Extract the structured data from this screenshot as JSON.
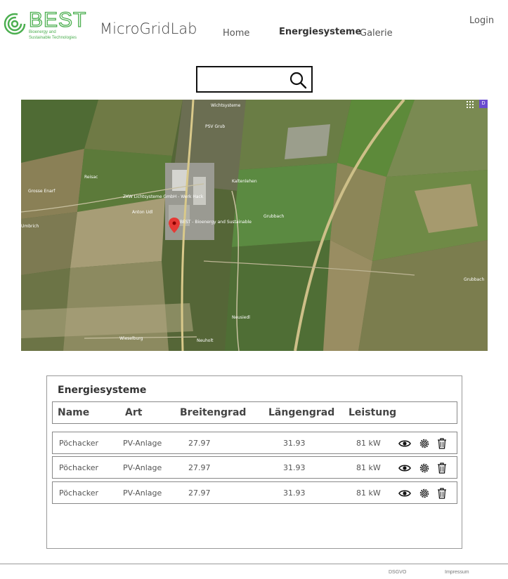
{
  "brand": {
    "logo_word": "BEST",
    "logo_sub_1": "Bioenergy and",
    "logo_sub_2": "Sustainable Technologies",
    "title": "MicroGridLab",
    "accent": "#4caf50"
  },
  "nav": {
    "home": "Home",
    "energy": "Energiesysteme",
    "gallery": "Galerie",
    "login": "Login"
  },
  "search": {
    "value": "",
    "placeholder": "",
    "icon": "search-icon"
  },
  "map": {
    "badge": "D",
    "labels": {
      "l1": "Wichtsysteme",
      "l2": "PSV Grub",
      "l3": "Grosse Enarf",
      "l4": "Reisac",
      "l5": "ZKW Lichtsysteme GmbH - Werk Hack",
      "l6": "Anton Udl",
      "l7": "BEST - Bioenergy and Sustainable",
      "l8": "Kaltenlehen",
      "l9": "Grubbach",
      "l10": "Grubbach",
      "l11": "Neusiedl",
      "l12": "Wieselburg",
      "l13": "Umbrich",
      "l14": "Neuholt"
    }
  },
  "table": {
    "title": "Energiesysteme",
    "headers": {
      "name": "Name",
      "type": "Art",
      "lat": "Breitengrad",
      "lon": "Längengrad",
      "power": "Leistung"
    },
    "rows": [
      {
        "name": "Pöchacker",
        "type": "PV-Anlage",
        "lat": "27.97",
        "lon": "31.93",
        "power": "81 kW"
      },
      {
        "name": "Pöchacker",
        "type": "PV-Anlage",
        "lat": "27.97",
        "lon": "31.93",
        "power": "81 kW"
      },
      {
        "name": "Pöchacker",
        "type": "PV-Anlage",
        "lat": "27.97",
        "lon": "31.93",
        "power": "81 kW"
      }
    ],
    "actions": [
      "eye-icon",
      "gear-icon",
      "trash-icon"
    ]
  },
  "footer": {
    "dsgvo": "DSGVO",
    "impressum": "Impressum"
  }
}
